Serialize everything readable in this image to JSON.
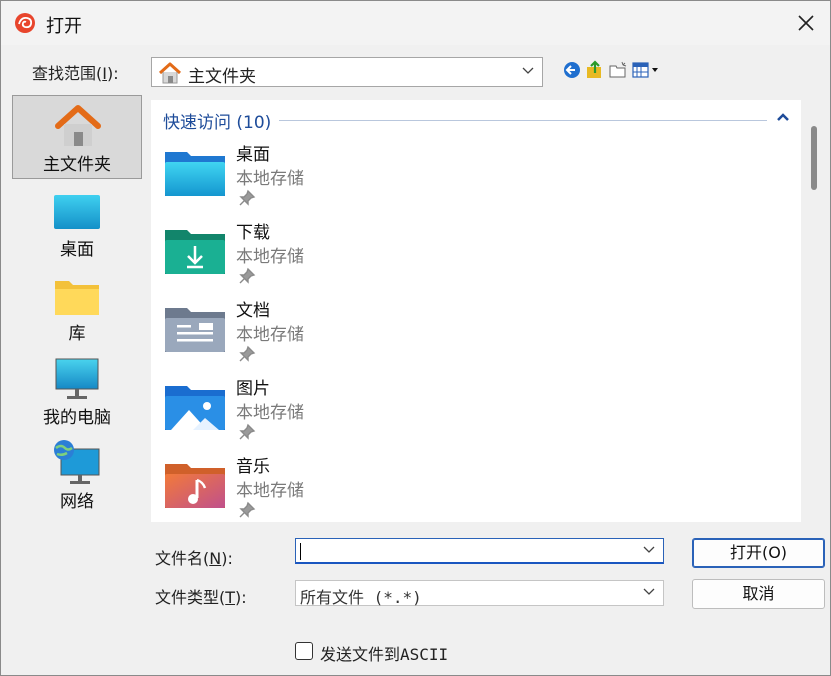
{
  "window": {
    "title": "打开"
  },
  "lookin": {
    "label_prefix": "查找范围(",
    "accel": "I",
    "label_suffix": "):",
    "value": "主文件夹"
  },
  "places": [
    {
      "label": "主文件夹",
      "icon": "home-icon"
    },
    {
      "label": "桌面",
      "icon": "desktop-icon"
    },
    {
      "label": "库",
      "icon": "library-folder-icon"
    },
    {
      "label": "我的电脑",
      "icon": "computer-monitor-icon"
    },
    {
      "label": "网络",
      "icon": "network-globe-icon"
    }
  ],
  "group": {
    "title": "快速访问 (10)"
  },
  "items": [
    {
      "name": "桌面",
      "location": "本地存储",
      "icon": "desktop-folder-icon"
    },
    {
      "name": "下载",
      "location": "本地存储",
      "icon": "downloads-folder-icon"
    },
    {
      "name": "文档",
      "location": "本地存储",
      "icon": "documents-folder-icon"
    },
    {
      "name": "图片",
      "location": "本地存储",
      "icon": "pictures-folder-icon"
    },
    {
      "name": "音乐",
      "location": "本地存储",
      "icon": "music-folder-icon"
    }
  ],
  "filename": {
    "label_prefix": "文件名(",
    "accel": "N",
    "label_suffix": "):",
    "value": ""
  },
  "filetype": {
    "label_prefix": "文件类型(",
    "accel": "T",
    "label_suffix": "):",
    "value": "所有文件 (*.*)"
  },
  "buttons": {
    "open": "打开(O)",
    "cancel": "取消"
  },
  "ascii": {
    "label": "发送文件到ASCII",
    "checked": false
  },
  "colors": {
    "accent": "#2a62b8",
    "group_header": "#1e4c9a",
    "secondary_text": "#7a7a7a"
  }
}
